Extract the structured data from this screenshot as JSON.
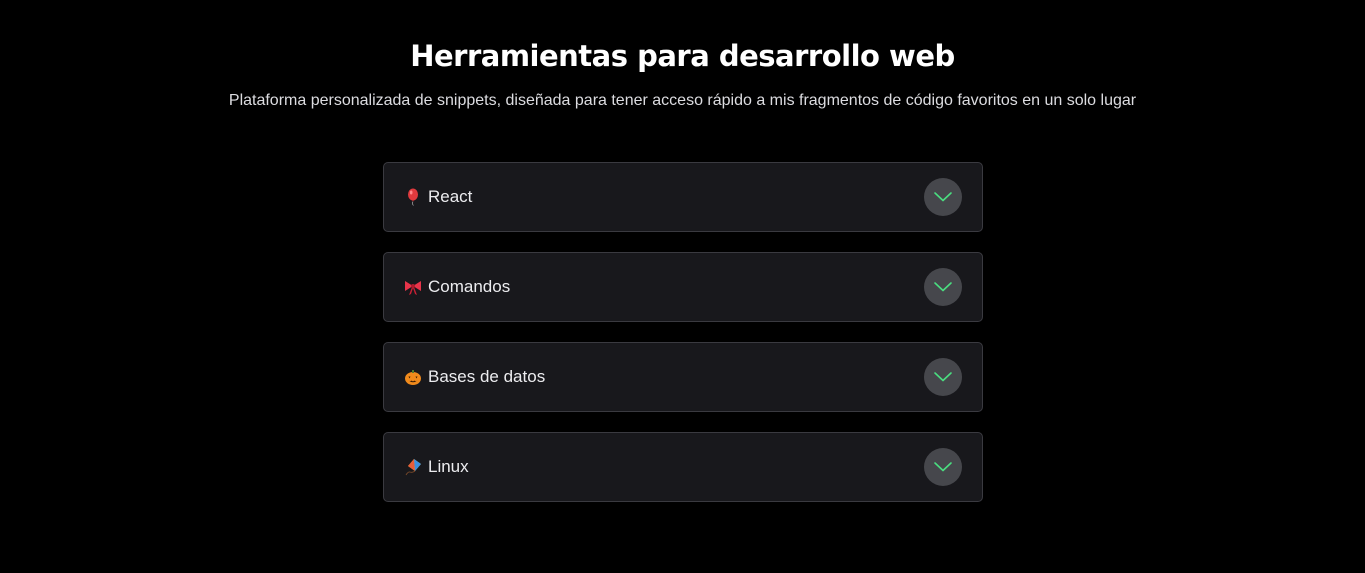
{
  "header": {
    "title": "Herramientas para desarrollo web",
    "subtitle": "Plataforma personalizada de snippets, diseñada para tener acceso rápido a mis fragmentos de código favoritos en un solo lugar"
  },
  "accordion": {
    "items": [
      {
        "label": "React",
        "icon": "balloon-icon"
      },
      {
        "label": "Comandos",
        "icon": "ribbon-bow-icon"
      },
      {
        "label": "Bases de datos",
        "icon": "jack-o-lantern-icon"
      },
      {
        "label": "Linux",
        "icon": "kite-icon"
      }
    ],
    "chevron_icon": "chevron-down-icon"
  },
  "colors": {
    "background": "#000000",
    "card_background": "#18181c",
    "card_border": "#3a3a40",
    "chevron_circle": "#46474c",
    "chevron_accent": "#4ade80"
  }
}
